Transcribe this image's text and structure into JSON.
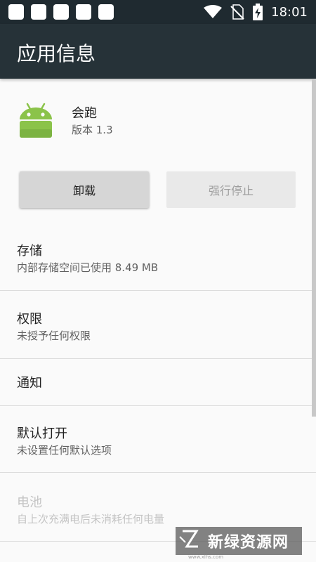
{
  "status_bar": {
    "time": "18:01",
    "left_icons": [
      "notification-square-icon",
      "notification-square-icon",
      "notification-square-icon",
      "notification-square-icon",
      "notification-square-icon"
    ],
    "right_icons": [
      "wifi-icon",
      "no-sim-icon",
      "battery-charging-icon"
    ]
  },
  "app_bar": {
    "title": "应用信息"
  },
  "app": {
    "icon": "android-icon",
    "name": "会跑",
    "version": "版本 1.3"
  },
  "buttons": {
    "uninstall": "卸载",
    "force_stop": "强行停止"
  },
  "items": [
    {
      "title": "存储",
      "subtitle": "内部存储空间已使用 8.49 MB",
      "enabled": true
    },
    {
      "title": "权限",
      "subtitle": "未授予任何权限",
      "enabled": true
    },
    {
      "title": "通知",
      "enabled": true
    },
    {
      "title": "默认打开",
      "subtitle": "未设置任何默认选项",
      "enabled": true
    },
    {
      "title": "电池",
      "subtitle": "自上次充满电后未消耗任何电量",
      "enabled": false
    }
  ],
  "watermark": {
    "title": "新绿资源网",
    "subtitle": "www.xlhs.com"
  },
  "colors": {
    "status_bar": "#1f2a30",
    "app_bar": "#263238",
    "android_green": "#8bc34a",
    "background": "#fafafa"
  }
}
